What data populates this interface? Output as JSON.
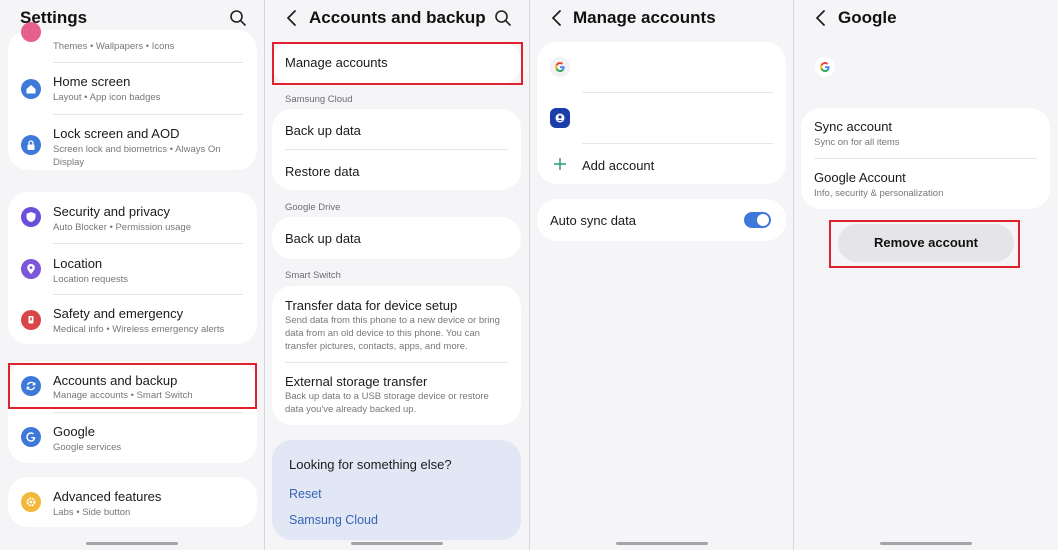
{
  "panels": {
    "settings": {
      "title": "Settings",
      "items": [
        {
          "sub": "Themes  •  Wallpapers  •  Icons"
        },
        {
          "label": "Home screen",
          "sub": "Layout  •  App icon badges"
        },
        {
          "label": "Lock screen and AOD",
          "sub": "Screen lock and biometrics  •  Always On Display"
        },
        {
          "label": "Security and privacy",
          "sub": "Auto Blocker  •  Permission usage"
        },
        {
          "label": "Location",
          "sub": "Location requests"
        },
        {
          "label": "Safety and emergency",
          "sub": "Medical info  •  Wireless emergency alerts"
        },
        {
          "label": "Accounts and backup",
          "sub": "Manage accounts  •  Smart Switch"
        },
        {
          "label": "Google",
          "sub": "Google services"
        },
        {
          "label": "Advanced features",
          "sub": "Labs  •  Side button"
        }
      ]
    },
    "accounts_backup": {
      "title": "Accounts and backup",
      "manage_accounts": "Manage accounts",
      "samsung_cloud_header": "Samsung Cloud",
      "back_up_data": "Back up data",
      "restore_data": "Restore data",
      "google_drive_header": "Google Drive",
      "gdrive_back_up_data": "Back up data",
      "smart_switch_header": "Smart Switch",
      "transfer_title": "Transfer data for device setup",
      "transfer_sub": "Send data from this phone to a new device or bring data from an old device to this phone. You can transfer pictures, contacts, apps, and more.",
      "external_title": "External storage transfer",
      "external_sub": "Back up data to a USB storage device or restore data you've already backed up.",
      "looking_title": "Looking for something else?",
      "reset_link": "Reset",
      "samsung_cloud_link": "Samsung Cloud"
    },
    "manage_accounts": {
      "title": "Manage accounts",
      "add_account": "Add account",
      "auto_sync": "Auto sync data",
      "auto_sync_on": true
    },
    "google": {
      "title": "Google",
      "sync_account": "Sync account",
      "sync_sub": "Sync on for all items",
      "google_account": "Google Account",
      "google_account_sub": "Info, security & personalization",
      "remove_account": "Remove account"
    }
  },
  "colors": {
    "highlight": "#e0222f",
    "toggle_on": "#3e78d8",
    "link": "#3a64b5",
    "background": "#f5f5f8"
  },
  "icons": [
    "search-icon",
    "back-icon",
    "home-screen-icon",
    "lock-icon",
    "shield-icon",
    "location-icon",
    "emergency-icon",
    "sync-icon",
    "google-icon",
    "gear-icon",
    "samsung-account-icon",
    "plus-icon"
  ]
}
